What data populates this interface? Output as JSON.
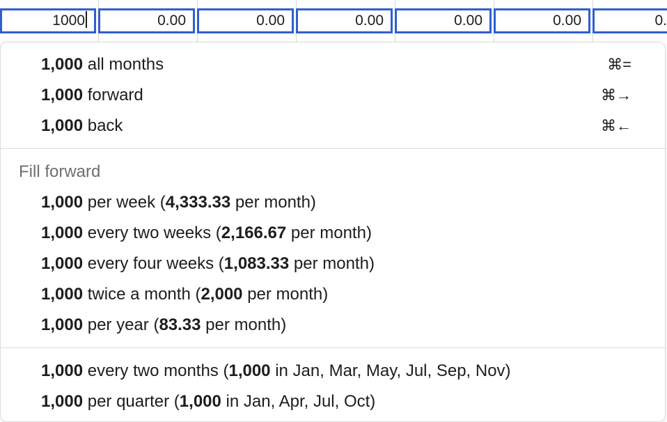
{
  "cells": [
    {
      "value": "1000",
      "active": true
    },
    {
      "value": "0.00"
    },
    {
      "value": "0.00"
    },
    {
      "value": "0.00"
    },
    {
      "value": "0.00"
    },
    {
      "value": "0.00"
    },
    {
      "value": "0."
    }
  ],
  "menu": {
    "quick": [
      {
        "amount": "1,000",
        "label": " all months",
        "shortcut": "⌘="
      },
      {
        "amount": "1,000",
        "label": " forward",
        "shortcut": "⌘→"
      },
      {
        "amount": "1,000",
        "label": " back",
        "shortcut": "⌘←"
      }
    ],
    "fill_forward_label": "Fill forward",
    "fill_forward": [
      {
        "amount": "1,000",
        "pre": " per week (",
        "monthly": "4,333.33",
        "post": " per month)"
      },
      {
        "amount": "1,000",
        "pre": " every two weeks (",
        "monthly": "2,166.67",
        "post": " per month)"
      },
      {
        "amount": "1,000",
        "pre": " every four weeks (",
        "monthly": "1,083.33",
        "post": " per month)"
      },
      {
        "amount": "1,000",
        "pre": " twice a month (",
        "monthly": "2,000",
        "post": " per month)"
      },
      {
        "amount": "1,000",
        "pre": " per year (",
        "monthly": "83.33",
        "post": " per month)"
      }
    ],
    "periodic": [
      {
        "amount": "1,000",
        "pre": " every two months (",
        "value": "1,000",
        "post": " in Jan, Mar, May, Jul, Sep, Nov)"
      },
      {
        "amount": "1,000",
        "pre": " per quarter (",
        "value": "1,000",
        "post": " in Jan, Apr, Jul, Oct)"
      }
    ]
  }
}
